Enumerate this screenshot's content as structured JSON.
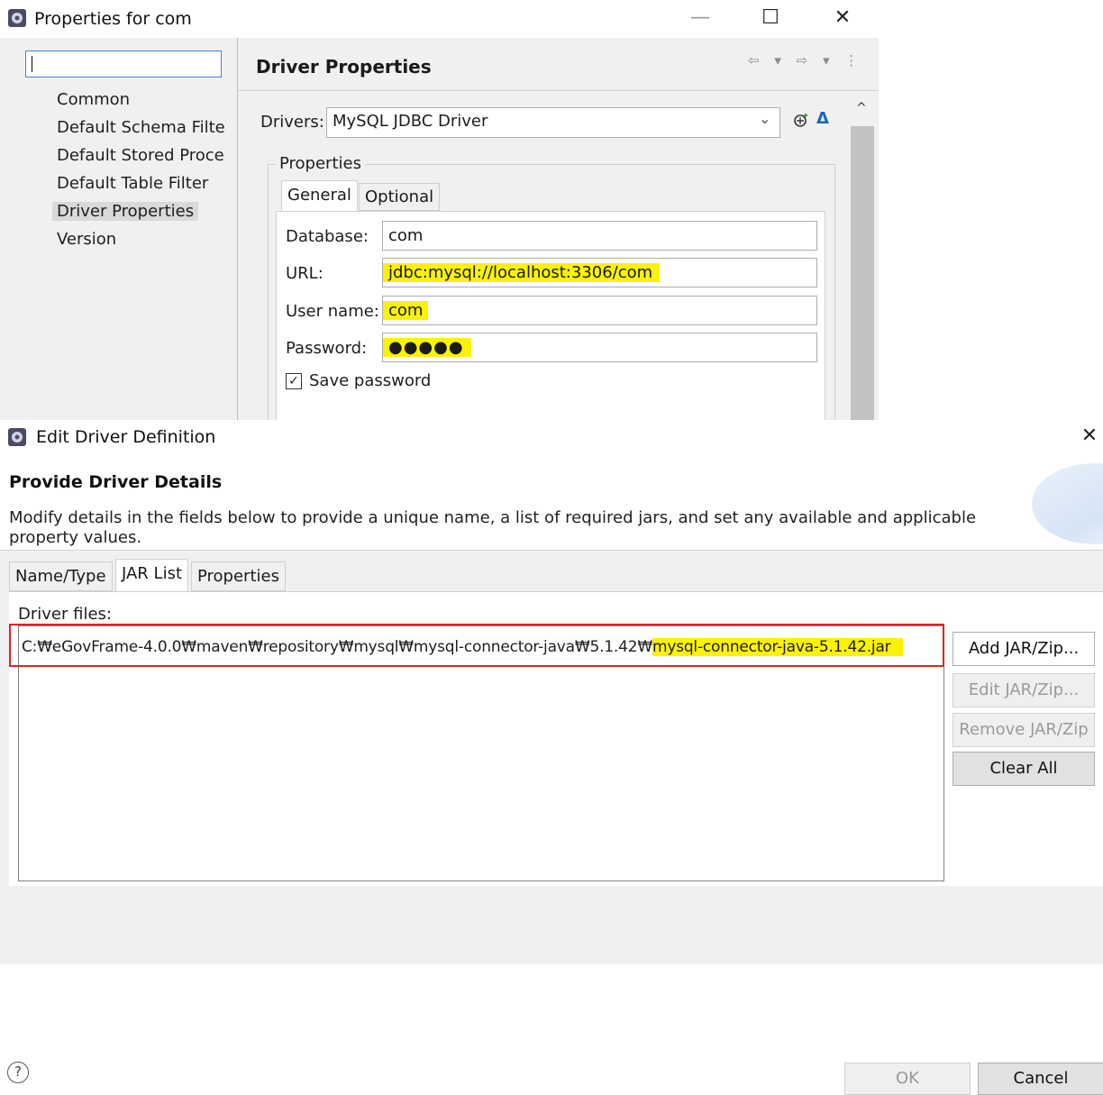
{
  "properties_window": {
    "title": "Properties for com",
    "controls": {
      "minimize": "—",
      "maximize": "☐",
      "close": "✕"
    },
    "filter_value": "",
    "tree_items": [
      "Common",
      "Default Schema Filte",
      "Default Stored Proce",
      "Default Table Filter",
      "Driver Properties",
      "Version"
    ],
    "selected_item": "Driver Properties",
    "page_title": "Driver Properties",
    "nav_icons": "⇦ ▾ ⇨ ▾ ⋮",
    "drivers_label": "Drivers:",
    "driver_selected": "MySQL JDBC Driver",
    "group_label": "Properties",
    "tabs": [
      "General",
      "Optional"
    ],
    "active_tab": "General",
    "fields": {
      "database": {
        "label": "Database:",
        "value": "com"
      },
      "url": {
        "label": "URL:",
        "value": "jdbc:mysql://localhost:3306/com"
      },
      "username": {
        "label": "User name:",
        "value": "com"
      },
      "password": {
        "label": "Password:",
        "value": "●●●●●"
      }
    },
    "save_password": {
      "label": "Save password",
      "checked": true
    }
  },
  "driver_dialog": {
    "title": "Edit Driver Definition",
    "close": "✕",
    "heading": "Provide Driver Details",
    "description": "Modify details in the fields below to provide a unique name, a list of required jars, and set any available and applicable property values.",
    "tabs": [
      "Name/Type",
      "JAR List",
      "Properties"
    ],
    "active_tab": "JAR List",
    "driver_files_label": "Driver files:",
    "jar_path_prefix": "C:₩eGovFrame-4.0.0₩maven₩repository₩mysql₩mysql-connector-java₩5.1.42₩",
    "jar_file_name": "mysql-connector-java-5.1.42.jar",
    "buttons": {
      "add": "Add JAR/Zip...",
      "edit": "Edit JAR/Zip...",
      "remove": "Remove JAR/Zip",
      "clear": "Clear All",
      "ok": "OK",
      "cancel": "Cancel"
    },
    "help": "?"
  },
  "colors": {
    "highlight": "#fbf205",
    "annotation_box": "#e5202a"
  }
}
